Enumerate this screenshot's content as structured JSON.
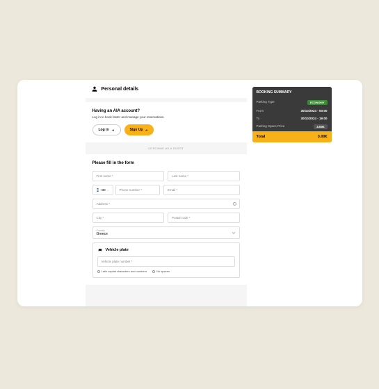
{
  "header": {
    "title": "Personal details"
  },
  "account": {
    "title": "Having an AIA account?",
    "subtitle": "Log in to book faster and manage your reservations.",
    "login": "Log in",
    "signup": "Sign Up"
  },
  "divider": "CONTINUE AS A GUEST",
  "form": {
    "title": "Please fill in the form",
    "first_name": "First name *",
    "last_name": "Last name *",
    "cc": "+30",
    "phone": "Phone number *",
    "email": "Email *",
    "address": "Address *",
    "city": "City *",
    "postal": "Postal code *",
    "country_label": "Country",
    "country_value": "Greece"
  },
  "vehicle": {
    "title": "Vehicle plate",
    "placeholder": "Vehicle plate number *",
    "rule1": "Latin capital characters and numbers",
    "rule2": "No spaces"
  },
  "summary": {
    "title": "BOOKING SUMMARY",
    "parking_type_label": "Parking Type",
    "parking_type_value": "ECONOMY",
    "from_label": "From",
    "from_value": "30/10/2024 - 00:00",
    "to_label": "To",
    "to_value": "30/10/2024 - 19:00",
    "space_label": "Parking Space Price",
    "space_value": "3.00€",
    "total_label": "Total",
    "total_value": "3.00€"
  }
}
